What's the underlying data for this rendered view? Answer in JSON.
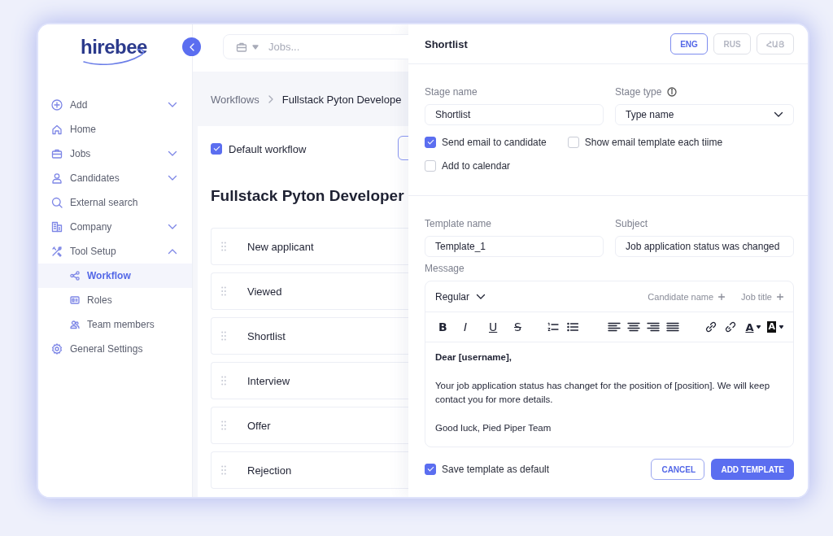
{
  "sidebar": {
    "logo": "hirebee",
    "items": [
      {
        "label": "Add",
        "kind": "group",
        "expanded": false
      },
      {
        "label": "Home",
        "kind": "link"
      },
      {
        "label": "Jobs",
        "kind": "group",
        "expanded": false
      },
      {
        "label": "Candidates",
        "kind": "group",
        "expanded": false
      },
      {
        "label": "External search",
        "kind": "link"
      },
      {
        "label": "Company",
        "kind": "group",
        "expanded": false
      },
      {
        "label": "Tool Setup",
        "kind": "group",
        "expanded": true,
        "children": [
          {
            "label": "Workflow",
            "selected": true
          },
          {
            "label": "Roles",
            "selected": false
          },
          {
            "label": "Team members",
            "selected": false
          }
        ]
      },
      {
        "label": "General Settings",
        "kind": "link"
      }
    ]
  },
  "main": {
    "search": {
      "placeholder": "Jobs..."
    },
    "breadcrumb": [
      "Workflows",
      "Fullstack Pyton Develope"
    ],
    "default_workflow": {
      "label": "Default workflow",
      "checked": true
    },
    "title": "Fullstack Pyton Developer",
    "stages": [
      "New applicant",
      "Viewed",
      "Shortlist",
      "Interview",
      "Offer",
      "Rejection"
    ]
  },
  "panel": {
    "title": "Shortlist",
    "languages": [
      {
        "label": "ENG",
        "selected": true
      },
      {
        "label": "RUS",
        "selected": false
      },
      {
        "label": "ՀԱՅ",
        "selected": false
      }
    ],
    "stage_name": {
      "label": "Stage name",
      "value": "Shortlist"
    },
    "stage_type": {
      "label": "Stage type",
      "value": "Type name"
    },
    "options": [
      {
        "label": "Send email to candidate",
        "checked": true
      },
      {
        "label": "Show email template each tiime",
        "checked": false
      },
      {
        "label": "Add to calendar",
        "checked": false
      }
    ],
    "template_name": {
      "label": "Template name",
      "value": "Template_1"
    },
    "subject": {
      "label": "Subject",
      "value": "Job application status was changed"
    },
    "message": {
      "label": "Message",
      "style": "Regular",
      "variables": [
        "Candidate name",
        "Job title"
      ],
      "format_buttons": [
        "B",
        "I",
        "U",
        "S"
      ],
      "color_buttons": [
        "A",
        "A"
      ],
      "body": [
        {
          "kind": "greeting",
          "text": "Dear [username],"
        },
        {
          "kind": "text",
          "text": "Your job application status has changet for the position of [position]. We will keep contact you for more details."
        },
        {
          "kind": "text",
          "text": "Good luck, Pied Piper Team"
        }
      ]
    },
    "save_default": {
      "label": "Save template as default",
      "checked": true
    },
    "buttons": [
      {
        "label": "CANCEL",
        "kind": "secondary"
      },
      {
        "label": "ADD TEMPLATE",
        "kind": "primary"
      }
    ]
  }
}
